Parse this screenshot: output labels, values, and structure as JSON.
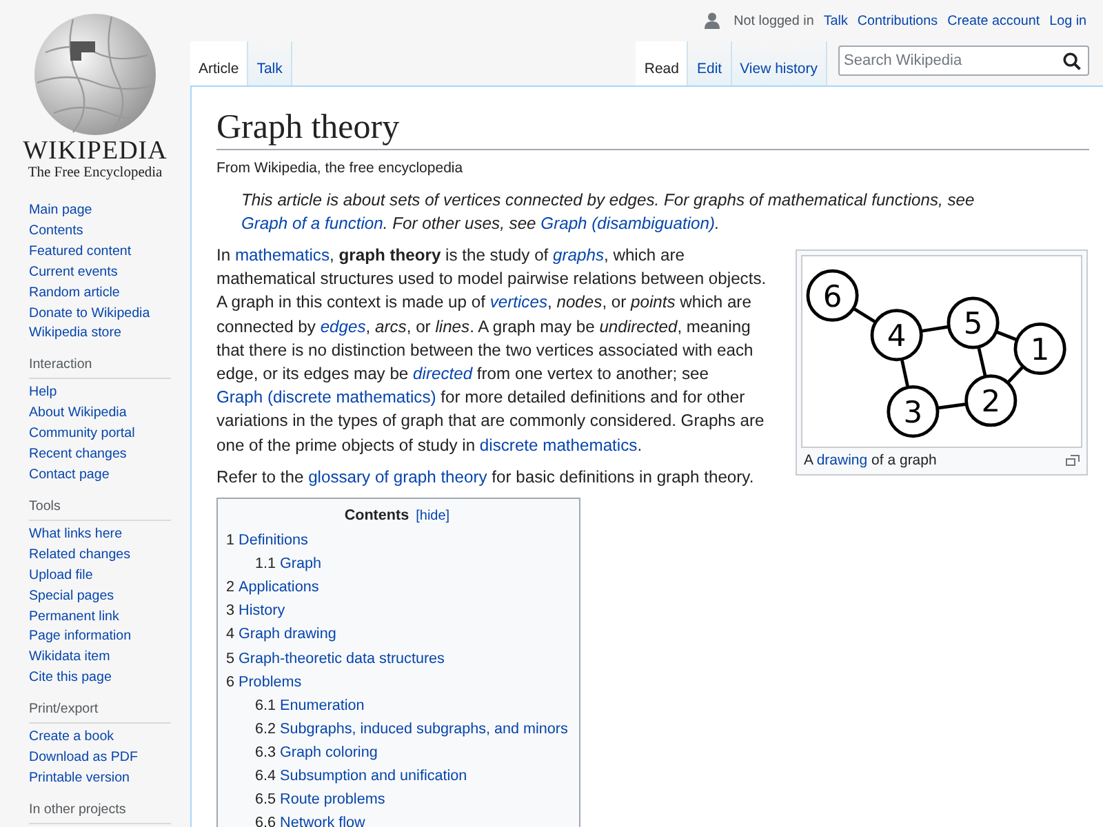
{
  "logo": {
    "wordmark": "WIKIPEDIA",
    "tagline": "The Free Encyclopedia"
  },
  "sidebar": {
    "sections": [
      {
        "items": [
          "Main page",
          "Contents",
          "Featured content",
          "Current events",
          "Random article",
          "Donate to Wikipedia",
          "Wikipedia store"
        ]
      },
      {
        "heading": "Interaction",
        "items": [
          "Help",
          "About Wikipedia",
          "Community portal",
          "Recent changes",
          "Contact page"
        ]
      },
      {
        "heading": "Tools",
        "items": [
          "What links here",
          "Related changes",
          "Upload file",
          "Special pages",
          "Permanent link",
          "Page information",
          "Wikidata item",
          "Cite this page"
        ]
      },
      {
        "heading": "Print/export",
        "items": [
          "Create a book",
          "Download as PDF",
          "Printable version"
        ]
      },
      {
        "heading": "In other projects"
      }
    ]
  },
  "personal_bar": {
    "status": "Not logged in",
    "links": [
      "Talk",
      "Contributions",
      "Create account",
      "Log in"
    ]
  },
  "left_tabs": [
    {
      "label": "Article",
      "selected": true
    },
    {
      "label": "Talk",
      "selected": false
    }
  ],
  "right_tabs": [
    {
      "label": "Read",
      "selected": true
    },
    {
      "label": "Edit",
      "selected": false
    },
    {
      "label": "View history",
      "selected": false
    }
  ],
  "search": {
    "placeholder": "Search Wikipedia"
  },
  "article": {
    "title": "Graph theory",
    "tagline": "From Wikipedia, the free encyclopedia",
    "hatnote": [
      {
        "kind": "text",
        "text": "This article is about sets of vertices connected by edges. For graphs of mathematical functions, see "
      },
      {
        "kind": "link",
        "text": "Graph of a function"
      },
      {
        "kind": "text",
        "text": ". For other uses, see "
      },
      {
        "kind": "link",
        "text": "Graph (disambiguation)"
      },
      {
        "kind": "text",
        "text": "."
      }
    ],
    "intro": [
      {
        "kind": "text",
        "text": "In "
      },
      {
        "kind": "link",
        "text": "mathematics"
      },
      {
        "kind": "text",
        "text": ", **graph theory** is the study of "
      },
      {
        "kind": "link",
        "text": "*graphs*"
      },
      {
        "kind": "text",
        "text": ", which are mathematical structures used to model pairwise relations between objects. A graph in this context is made up of "
      },
      {
        "kind": "link",
        "text": "*vertices*"
      },
      {
        "kind": "text",
        "text": ", *nodes*, or *points* which are connected by "
      },
      {
        "kind": "link",
        "text": "*edges*"
      },
      {
        "kind": "text",
        "text": ", *arcs*, or *lines*. A graph may be *undirected*, meaning that there is no distinction between the two vertices associated with each edge, or its edges may be "
      },
      {
        "kind": "link",
        "text": "*directed*"
      },
      {
        "kind": "text",
        "text": " from one vertex to another; see "
      },
      {
        "kind": "link",
        "text": "Graph (discrete mathematics)"
      },
      {
        "kind": "text",
        "text": " for more detailed definitions and for other variations in the types of graph that are commonly considered. Graphs are one of the prime objects of study in "
      },
      {
        "kind": "link",
        "text": "discrete mathematics"
      },
      {
        "kind": "text",
        "text": "."
      }
    ],
    "refer": [
      {
        "kind": "text",
        "text": "Refer to the "
      },
      {
        "kind": "link",
        "text": "glossary of graph theory"
      },
      {
        "kind": "text",
        "text": " for basic definitions in graph theory."
      }
    ],
    "figure": {
      "node_labels": [
        "6",
        "4",
        "5",
        "1",
        "3",
        "2"
      ],
      "caption": [
        {
          "kind": "text",
          "text": "A "
        },
        {
          "kind": "link",
          "text": "drawing"
        },
        {
          "kind": "text",
          "text": " of a graph"
        }
      ]
    },
    "toc": {
      "title": "Contents",
      "toggle": "[hide]",
      "items": [
        {
          "number": "1",
          "title": "Definitions",
          "children": [
            {
              "number": "1.1",
              "title": "Graph"
            }
          ]
        },
        {
          "number": "2",
          "title": "Applications"
        },
        {
          "number": "3",
          "title": "History"
        },
        {
          "number": "4",
          "title": "Graph drawing"
        },
        {
          "number": "5",
          "title": "Graph-theoretic data structures"
        },
        {
          "number": "6",
          "title": "Problems",
          "children": [
            {
              "number": "6.1",
              "title": "Enumeration"
            },
            {
              "number": "6.2",
              "title": "Subgraphs, induced subgraphs, and minors"
            },
            {
              "number": "6.3",
              "title": "Graph coloring"
            },
            {
              "number": "6.4",
              "title": "Subsumption and unification"
            },
            {
              "number": "6.5",
              "title": "Route problems"
            },
            {
              "number": "6.6",
              "title": "Network flow"
            }
          ]
        }
      ]
    }
  }
}
